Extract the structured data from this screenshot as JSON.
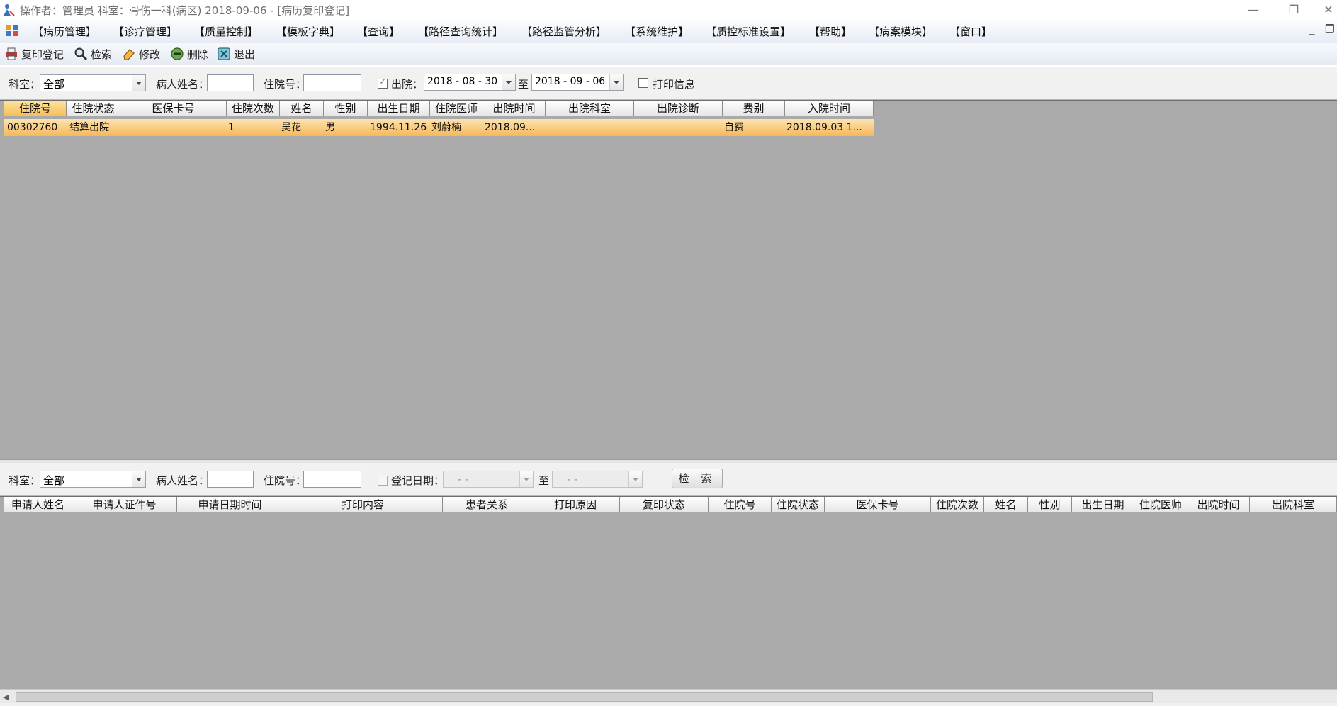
{
  "window": {
    "title": "操作者：管理员  科室：骨伤一科(病区)  2018-09-06 - [病历复印登记]",
    "controls": {
      "minimize": "—",
      "restore": "❐",
      "close": "✕"
    }
  },
  "menu": {
    "items": [
      "【病历管理】",
      "【诊疗管理】",
      "【质量控制】",
      "【模板字典】",
      "【查询】",
      "【路径查询统计】",
      "【路径监管分析】",
      "【系统维护】",
      "【质控标准设置】",
      "【帮助】",
      "【病案模块】",
      "【窗口】"
    ],
    "mdi_min": "_",
    "mdi_restore": "❐"
  },
  "toolbar": {
    "buttons": [
      {
        "label": "复印登记",
        "icon": "print-register-icon"
      },
      {
        "label": "检索",
        "icon": "magnifier-icon"
      },
      {
        "label": "修改",
        "icon": "eraser-edit-icon"
      },
      {
        "label": "删除",
        "icon": "delete-minus-icon"
      },
      {
        "label": "退出",
        "icon": "exit-x-icon"
      }
    ]
  },
  "top_filter": {
    "dept_label": "科室：",
    "dept_value": "全部",
    "patient_name_label": "病人姓名：",
    "patient_name_value": "",
    "inpatient_no_label": "住院号：",
    "inpatient_no_value": "",
    "discharge_checked": true,
    "discharge_label": "出院：",
    "date_from": "2018 - 08 - 30",
    "to_label": "至",
    "date_to": "2018 - 09 - 06",
    "print_info_checked": false,
    "print_info_label": "打印信息"
  },
  "top_grid": {
    "columns": [
      "住院号",
      "住院状态",
      "医保卡号",
      "住院次数",
      "姓名",
      "性别",
      "出生日期",
      "住院医师",
      "出院时间",
      "出院科室",
      "出院诊断",
      "费别",
      "入院时间"
    ],
    "rows": [
      [
        "00302760",
        "结算出院",
        "",
        "1",
        "吴花",
        "男",
        "1994.11.26",
        "刘蔚楠",
        "2018.09...",
        "",
        "",
        "自费",
        "2018.09.03 1..."
      ]
    ]
  },
  "bottom_filter": {
    "dept_label": "科室：",
    "dept_value": "全部",
    "patient_name_label": "病人姓名：",
    "patient_name_value": "",
    "inpatient_no_label": "住院号：",
    "inpatient_no_value": "",
    "register_date_checked": false,
    "register_date_label": "登记日期：",
    "date_from": "-    -",
    "to_label": "至",
    "date_to": "-    -",
    "search_button": "检 索"
  },
  "bottom_grid": {
    "columns": [
      "申请人姓名",
      "申请人证件号",
      "申请日期时间",
      "打印内容",
      "患者关系",
      "打印原因",
      "复印状态",
      "住院号",
      "住院状态",
      "医保卡号",
      "住院次数",
      "姓名",
      "性别",
      "出生日期",
      "住院医师",
      "出院时间",
      "出院科室"
    ],
    "rows": []
  },
  "colors": {
    "grid_bg": "#aaaaaa",
    "selected_row": "#f7b75a",
    "toolbar_bg": "#e6ebf3"
  }
}
